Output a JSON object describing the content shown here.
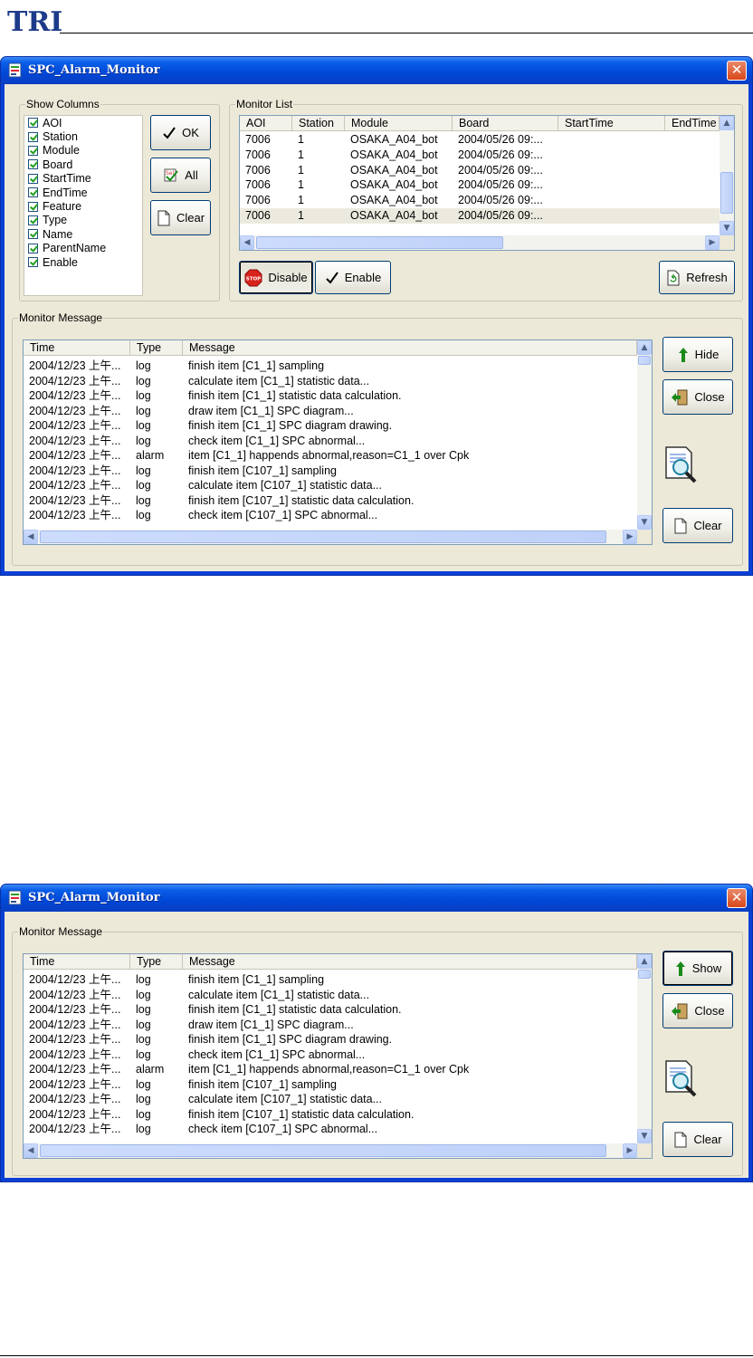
{
  "page": {
    "logo_text": "TRI"
  },
  "window1": {
    "title": "SPC_Alarm_Monitor",
    "show_columns": {
      "legend": "Show Columns",
      "items": [
        "AOI",
        "Station",
        "Module",
        "Board",
        "StartTime",
        "EndTime",
        "Feature",
        "Type",
        "Name",
        "ParentName",
        "Enable"
      ],
      "ok_label": "OK",
      "all_label": "All",
      "clear_label": "Clear"
    },
    "monitor_list": {
      "legend": "Monitor List",
      "columns": [
        "AOI",
        "Station",
        "Module",
        "Board",
        "StartTime",
        "EndTime"
      ],
      "rows": [
        [
          "7006",
          "1",
          "OSAKA_A04_bot",
          "2004/05/26 09:..."
        ],
        [
          "7006",
          "1",
          "OSAKA_A04_bot",
          "2004/05/26 09:..."
        ],
        [
          "7006",
          "1",
          "OSAKA_A04_bot",
          "2004/05/26 09:..."
        ],
        [
          "7006",
          "1",
          "OSAKA_A04_bot",
          "2004/05/26 09:..."
        ],
        [
          "7006",
          "1",
          "OSAKA_A04_bot",
          "2004/05/26 09:..."
        ],
        [
          "7006",
          "1",
          "OSAKA_A04_bot",
          "2004/05/26 09:..."
        ]
      ],
      "disable_label": "Disable",
      "stop_icon_text": "STOP",
      "enable_label": "Enable",
      "refresh_label": "Refresh"
    },
    "monitor_message": {
      "legend": "Monitor Message",
      "columns": [
        "Time",
        "Type",
        "Message"
      ],
      "rows": [
        [
          "2004/12/23 上午...",
          "log",
          "finish item [C1_1] sampling"
        ],
        [
          "2004/12/23 上午...",
          "log",
          "calculate item [C1_1] statistic data..."
        ],
        [
          "2004/12/23 上午...",
          "log",
          "finish item [C1_1] statistic data calculation."
        ],
        [
          "2004/12/23 上午...",
          "log",
          "draw item [C1_1] SPC diagram..."
        ],
        [
          "2004/12/23 上午...",
          "log",
          "finish item [C1_1] SPC diagram drawing."
        ],
        [
          "2004/12/23 上午...",
          "log",
          "check item [C1_1] SPC abnormal..."
        ],
        [
          "2004/12/23 上午...",
          "alarm",
          "item [C1_1] happends abnormal,reason=C1_1 over Cpk"
        ],
        [
          "2004/12/23 上午...",
          "log",
          "finish item [C107_1] sampling"
        ],
        [
          "2004/12/23 上午...",
          "log",
          "calculate item [C107_1] statistic data..."
        ],
        [
          "2004/12/23 上午...",
          "log",
          "finish item [C107_1] statistic data calculation."
        ],
        [
          "2004/12/23 上午...",
          "log",
          "check item [C107_1] SPC abnormal..."
        ]
      ],
      "hide_label": "Hide",
      "close_label": "Close",
      "clear_label": "Clear"
    }
  },
  "window2": {
    "title": "SPC_Alarm_Monitor",
    "monitor_message": {
      "legend": "Monitor Message",
      "columns": [
        "Time",
        "Type",
        "Message"
      ],
      "rows": [
        [
          "2004/12/23 上午...",
          "log",
          "finish item [C1_1] sampling"
        ],
        [
          "2004/12/23 上午...",
          "log",
          "calculate item [C1_1] statistic data..."
        ],
        [
          "2004/12/23 上午...",
          "log",
          "finish item [C1_1] statistic data calculation."
        ],
        [
          "2004/12/23 上午...",
          "log",
          "draw item [C1_1] SPC diagram..."
        ],
        [
          "2004/12/23 上午...",
          "log",
          "finish item [C1_1] SPC diagram drawing."
        ],
        [
          "2004/12/23 上午...",
          "log",
          "check item [C1_1] SPC abnormal..."
        ],
        [
          "2004/12/23 上午...",
          "alarm",
          "item [C1_1] happends abnormal,reason=C1_1 over Cpk"
        ],
        [
          "2004/12/23 上午...",
          "log",
          "finish item [C107_1] sampling"
        ],
        [
          "2004/12/23 上午...",
          "log",
          "calculate item [C107_1] statistic data..."
        ],
        [
          "2004/12/23 上午...",
          "log",
          "finish item [C107_1] statistic data calculation."
        ],
        [
          "2004/12/23 上午...",
          "log",
          "check item [C107_1] SPC abnormal..."
        ]
      ],
      "show_label": "Show",
      "close_label": "Close",
      "clear_label": "Clear"
    }
  }
}
